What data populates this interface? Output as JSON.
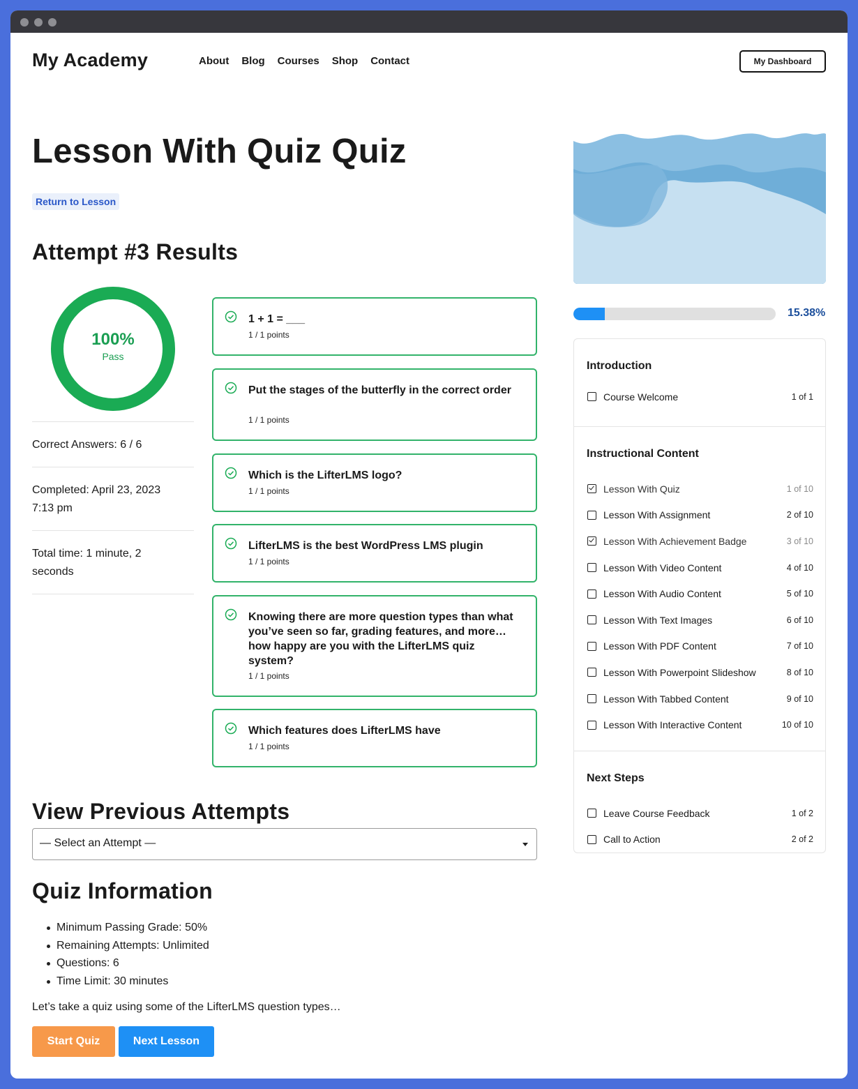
{
  "header": {
    "logo": "My Academy",
    "nav": [
      "About",
      "Blog",
      "Courses",
      "Shop",
      "Contact"
    ],
    "dashboard_button": "My Dashboard"
  },
  "page": {
    "title": "Lesson With Quiz Quiz",
    "return_link": "Return to Lesson",
    "attempt_heading": "Attempt #3 Results"
  },
  "result": {
    "percent": "100%",
    "status": "Pass",
    "score_fraction": 1.0,
    "colors": {
      "pass": "#1aab54"
    },
    "stats": [
      "Correct Answers: 6 / 6",
      "Completed: April 23, 2023 7:13 pm",
      "Total time: 1 minute, 2 seconds"
    ]
  },
  "questions": [
    {
      "title": "1 + 1 = ___",
      "points": "1 / 1 points"
    },
    {
      "title": "Put the stages of the butterfly in the correct order",
      "points": "1 / 1 points"
    },
    {
      "title": "Which is the LifterLMS logo?",
      "points": "1 / 1 points"
    },
    {
      "title": "LifterLMS is the best WordPress LMS plugin",
      "points": "1 / 1 points"
    },
    {
      "title": "Knowing there are more question types than what you’ve seen so far, grading features, and more… how happy are you with the LifterLMS quiz system?",
      "points": "1 / 1 points"
    },
    {
      "title": "Which features does LifterLMS have",
      "points": "1 / 1 points"
    }
  ],
  "previous_attempts": {
    "heading": "View Previous Attempts",
    "selected": "— Select an Attempt —"
  },
  "quiz_info": {
    "heading": "Quiz Information",
    "items": [
      "Minimum Passing Grade: 50%",
      "Remaining Attempts: Unlimited",
      "Questions: 6",
      "Time Limit: 30 minutes"
    ],
    "description": "Let’s take a quiz using some of the LifterLMS question types…",
    "start_button": "Start Quiz",
    "next_button": "Next Lesson"
  },
  "sidebar": {
    "progress_percent": 15.38,
    "progress_label": "15.38%",
    "colors": {
      "progress": "#1e90f5",
      "start": "#f7994a"
    },
    "sections": [
      {
        "title": "Introduction",
        "lessons": [
          {
            "name": "Course Welcome",
            "count": "1 of 1",
            "done": false
          }
        ]
      },
      {
        "title": "Instructional Content",
        "lessons": [
          {
            "name": "Lesson With Quiz",
            "count": "1 of 10",
            "done": true
          },
          {
            "name": "Lesson With Assignment",
            "count": "2 of 10",
            "done": false
          },
          {
            "name": "Lesson With Achievement Badge",
            "count": "3 of 10",
            "done": true
          },
          {
            "name": "Lesson With Video Content",
            "count": "4 of 10",
            "done": false
          },
          {
            "name": "Lesson With Audio Content",
            "count": "5 of 10",
            "done": false
          },
          {
            "name": "Lesson With Text Images",
            "count": "6 of 10",
            "done": false
          },
          {
            "name": "Lesson With PDF Content",
            "count": "7 of 10",
            "done": false
          },
          {
            "name": "Lesson With Powerpoint Slideshow",
            "count": "8 of 10",
            "done": false
          },
          {
            "name": "Lesson With Tabbed Content",
            "count": "9 of 10",
            "done": false
          },
          {
            "name": "Lesson With Interactive Content",
            "count": "10 of 10",
            "done": false
          }
        ]
      },
      {
        "title": "Next Steps",
        "lessons": [
          {
            "name": "Leave Course Feedback",
            "count": "1 of 2",
            "done": false
          },
          {
            "name": "Call to Action",
            "count": "2 of 2",
            "done": false
          }
        ]
      }
    ]
  }
}
